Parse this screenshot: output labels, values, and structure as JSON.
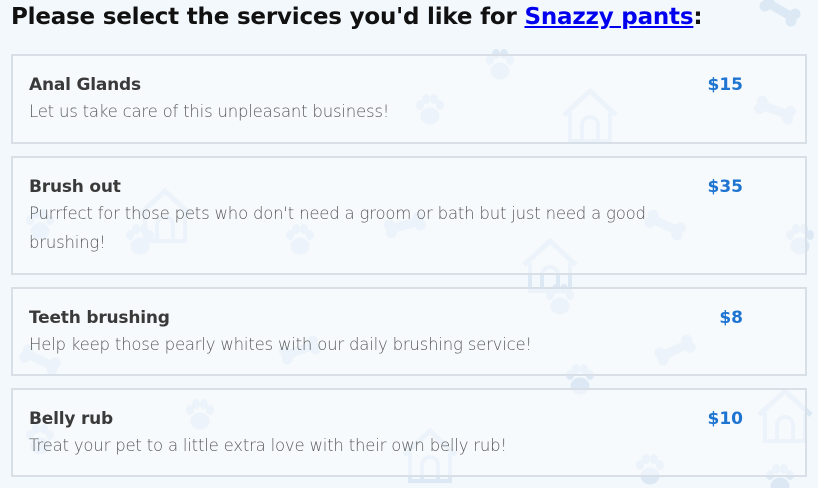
{
  "heading": {
    "prefix": "Please select the services you'd like for ",
    "pet_name": "Snazzy pants",
    "suffix": ":"
  },
  "services": [
    {
      "name": "Anal Glands",
      "description": "Let us take care of this unpleasant business!",
      "price": "$15"
    },
    {
      "name": "Brush out",
      "description": "Purrfect for those pets who don't need a groom or bath but just need a good brushing!",
      "price": "$35"
    },
    {
      "name": "Teeth brushing",
      "description": "Help keep those pearly whites with our daily brushing service!",
      "price": "$8"
    },
    {
      "name": "Belly rub",
      "description": "Treat your pet to a little extra love with their own belly rub!",
      "price": "$10"
    }
  ],
  "colors": {
    "price": "#1e74d1",
    "link": "#0000ee",
    "card_border": "#d8dfe6",
    "background": "#f3f8fc"
  },
  "background_icons": [
    "paw-print-icon",
    "dog-bone-icon",
    "doghouse-icon"
  ]
}
